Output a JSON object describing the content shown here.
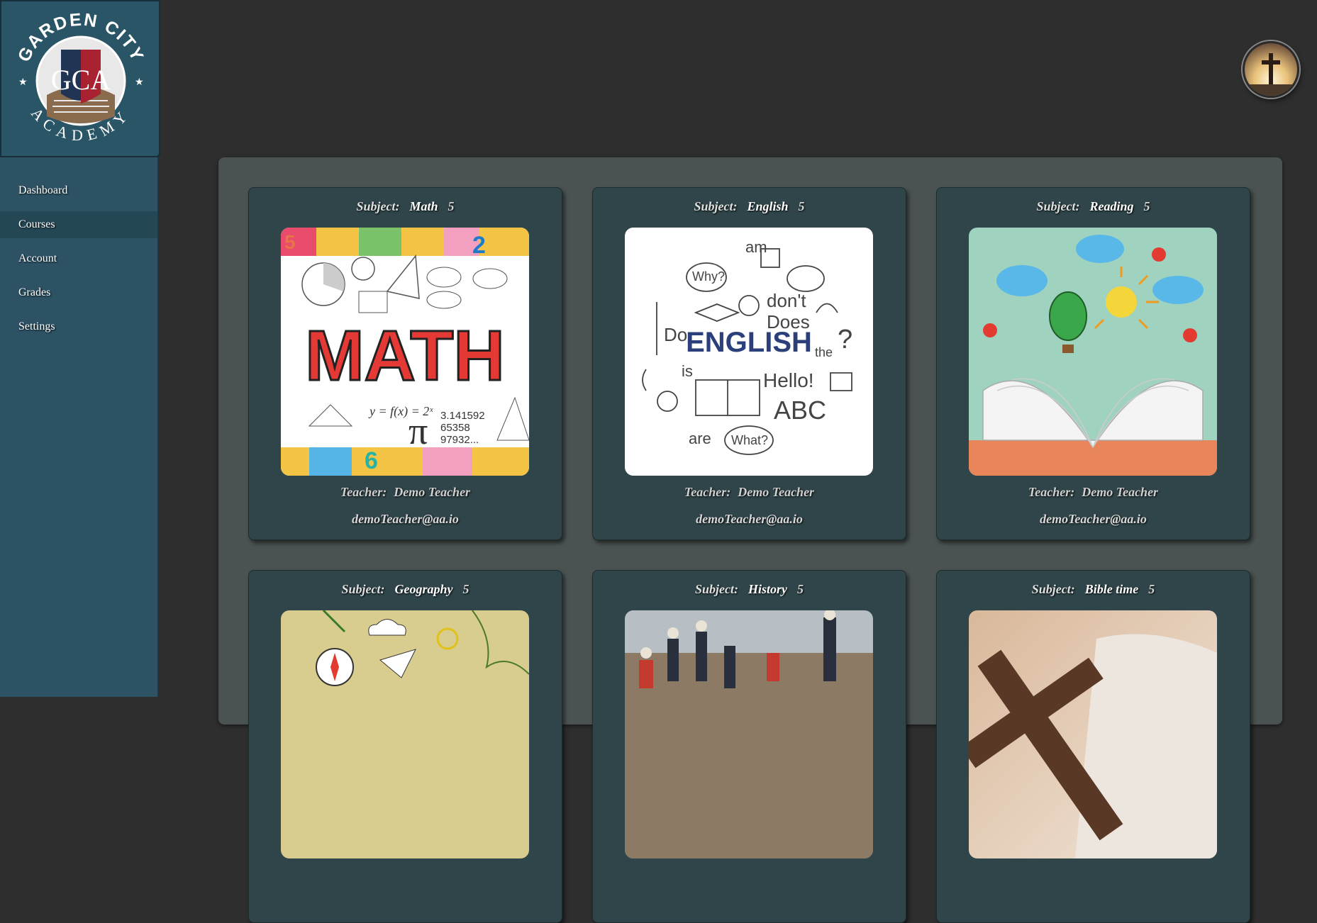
{
  "logo": {
    "top_text": "GARDEN CITY",
    "bottom_text": "ACADEMY",
    "monogram": "GCA"
  },
  "nav": {
    "items": [
      {
        "label": "Dashboard"
      },
      {
        "label": "Courses",
        "active": true
      },
      {
        "label": "Account"
      },
      {
        "label": "Grades"
      },
      {
        "label": "Settings"
      }
    ]
  },
  "profile": {
    "icon": "cross-avatar-icon"
  },
  "colors": {
    "sidebar": "#2c5264",
    "panel": "#4b5252",
    "card": "#2f4549",
    "background": "#2e2e2e"
  },
  "courses": [
    {
      "subject_label": "Subject:",
      "subject": "Math",
      "count": "5",
      "teacher_label": "Teacher:",
      "teacher": "Demo Teacher",
      "email": "demoTeacher@aa.io",
      "image_text": "MATH"
    },
    {
      "subject_label": "Subject:",
      "subject": "English",
      "count": "5",
      "teacher_label": "Teacher:",
      "teacher": "Demo Teacher",
      "email": "demoTeacher@aa.io",
      "image_text": "ENGLISH"
    },
    {
      "subject_label": "Subject:",
      "subject": "Reading",
      "count": "5",
      "teacher_label": "Teacher:",
      "teacher": "Demo Teacher",
      "email": "demoTeacher@aa.io"
    },
    {
      "subject_label": "Subject:",
      "subject": "Geography",
      "count": "5"
    },
    {
      "subject_label": "Subject:",
      "subject": "History",
      "count": "5"
    },
    {
      "subject_label": "Subject:",
      "subject": "Bible time",
      "count": "5"
    }
  ]
}
